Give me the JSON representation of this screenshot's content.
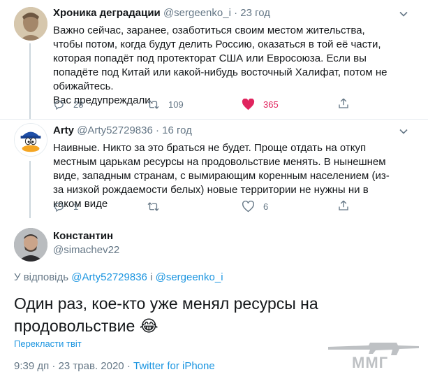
{
  "tweet1": {
    "name": "Хроника деградации",
    "handle": "@sergeenko_i",
    "sep": "·",
    "time": "23 год",
    "text": "Важно сейчас, заранее, озаботиться своим местом жительства, чтобы потом, когда будут делить Россию, оказаться в той её части, которая попадёт под протекторат США или Евросоюза. Если вы попадёте под Китай или какой-нибудь восточный Халифат, потом не обижайтесь.\nВас предупреждали.",
    "replies": "28",
    "retweets": "109",
    "likes": "365"
  },
  "tweet2": {
    "name": "Arty",
    "handle": "@Arty52729836",
    "sep": "·",
    "time": "16 год",
    "text": "Наивные. Никто за это браться не будет. Проще отдать на откуп местным царькам ресурсы на продовольствие менять. В нынешнем виде, западным странам, с вымирающим коренным населением (из-за низкой рождаемости белых) новые территории не нужны ни в каком виде",
    "replies": "1",
    "likes": "6"
  },
  "main": {
    "name": "Константин",
    "handle": "@simachev22",
    "reply_prefix": "У відповідь",
    "reply_user1": "@Arty52729836",
    "reply_and": "і",
    "reply_user2": "@sergeenko_i",
    "text": "Один раз, кое-кто уже менял ресурсы на продовольствие",
    "emoji": "😂",
    "translate": "Перекласти твіт",
    "timestamp": "9:39 дп · 23 трав. 2020 ·",
    "client": "Twitter for iPhone"
  },
  "watermark": "ММГ",
  "colors": {
    "accent": "#1b95e0",
    "like": "#e0245e",
    "muted": "#657786"
  }
}
